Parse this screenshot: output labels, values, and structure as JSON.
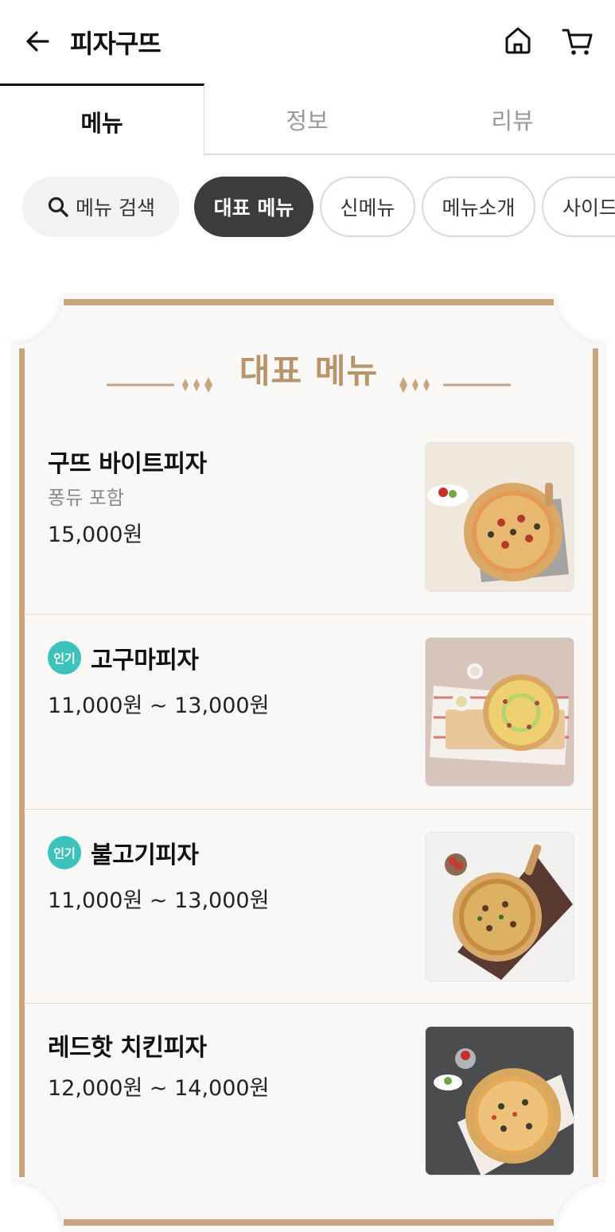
{
  "header": {
    "title": "피자구뜨",
    "back_icon": "arrow-left-icon",
    "home_icon": "home-icon",
    "cart_icon": "cart-icon"
  },
  "tabs": [
    {
      "label": "메뉴",
      "active": true
    },
    {
      "label": "정보",
      "active": false
    },
    {
      "label": "리뷰",
      "active": false
    }
  ],
  "chips": {
    "search_label": "메뉴 검색",
    "items": [
      "대표 메뉴",
      "신메뉴",
      "메뉴소개",
      "사이드"
    ],
    "selected": "대표 메뉴"
  },
  "section": {
    "title": "대표 메뉴",
    "accent_color": "#b8946a"
  },
  "menu_items": [
    {
      "name": "구뜨 바이트피자",
      "desc": "퐁듀 포함",
      "price": "15,000원",
      "badge": ""
    },
    {
      "name": "고구마피자",
      "desc": "",
      "price": "11,000원 ~ 13,000원",
      "badge": "인기"
    },
    {
      "name": "불고기피자",
      "desc": "",
      "price": "11,000원 ~ 13,000원",
      "badge": "인기"
    },
    {
      "name": "레드핫 치킨피자",
      "desc": "",
      "price": "12,000원 ~ 14,000원",
      "badge": ""
    }
  ],
  "colors": {
    "badge": "#3cc2b8",
    "frame": "#c9a57e",
    "chip_selected": "#3c3c3c"
  }
}
